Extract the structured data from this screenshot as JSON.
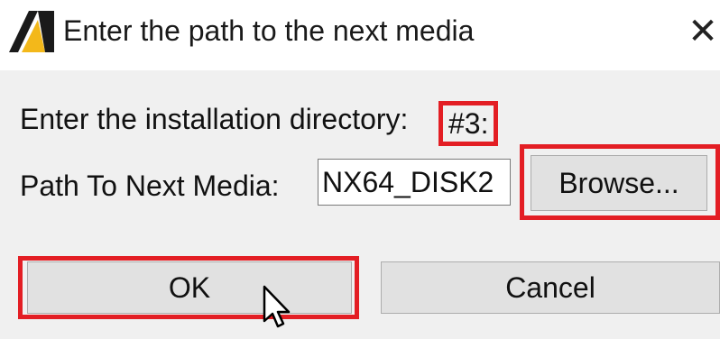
{
  "dialog": {
    "title": "Enter the path to the next media",
    "app_icon": "autodesk-logo-icon",
    "close_glyph": "✕"
  },
  "form": {
    "install_label": "Enter the installation directory:",
    "install_placeholder": "#3:",
    "path_label": "Path To Next Media:",
    "path_value": "NX64_DISK2"
  },
  "buttons": {
    "browse": "Browse...",
    "ok": "OK",
    "cancel": "Cancel"
  },
  "colors": {
    "highlight": "#e31e24",
    "titlebar": "#ffffff",
    "background": "#f0f0f0",
    "button_face": "#e1e1e1"
  }
}
